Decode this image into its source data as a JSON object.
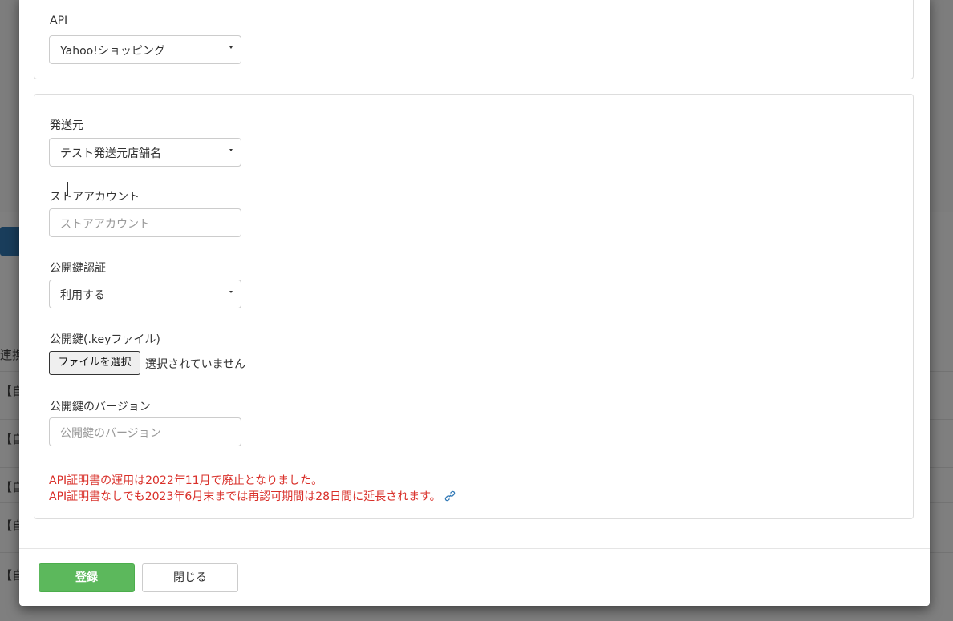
{
  "background": {
    "list_rows": [
      {
        "prefix": "連携"
      },
      {
        "prefix": "【自"
      },
      {
        "prefix": "【自"
      },
      {
        "prefix": "【自"
      },
      {
        "prefix": "【自"
      },
      {
        "prefix": "【自"
      }
    ]
  },
  "api_section": {
    "label": "API",
    "selected": "Yahoo!ショッピング"
  },
  "form": {
    "sender": {
      "label": "発送元",
      "selected": "テスト発送元店舗名"
    },
    "store_account": {
      "label": "ストアアカウント",
      "placeholder": "ストアアカウント",
      "value": ""
    },
    "public_key_auth": {
      "label": "公開鍵認証",
      "selected": "利用する"
    },
    "public_key_file": {
      "label": "公開鍵(.keyファイル)",
      "button": "ファイルを選択",
      "status": "選択されていません"
    },
    "public_key_version": {
      "label": "公開鍵のバージョン",
      "placeholder": "公開鍵のバージョン",
      "value": ""
    },
    "notices": [
      "API証明書の運用は2022年11月で廃止となりました。",
      "API証明書なしでも2023年6月末までは再認可期間は28日間に延長されます。"
    ]
  },
  "footer": {
    "submit_label": "登録",
    "close_label": "閉じる"
  },
  "colors": {
    "primary": "#5cb85c",
    "warning": "#d9302a",
    "link": "#337ab7",
    "overlay": "rgba(0,0,0,0.5)"
  }
}
